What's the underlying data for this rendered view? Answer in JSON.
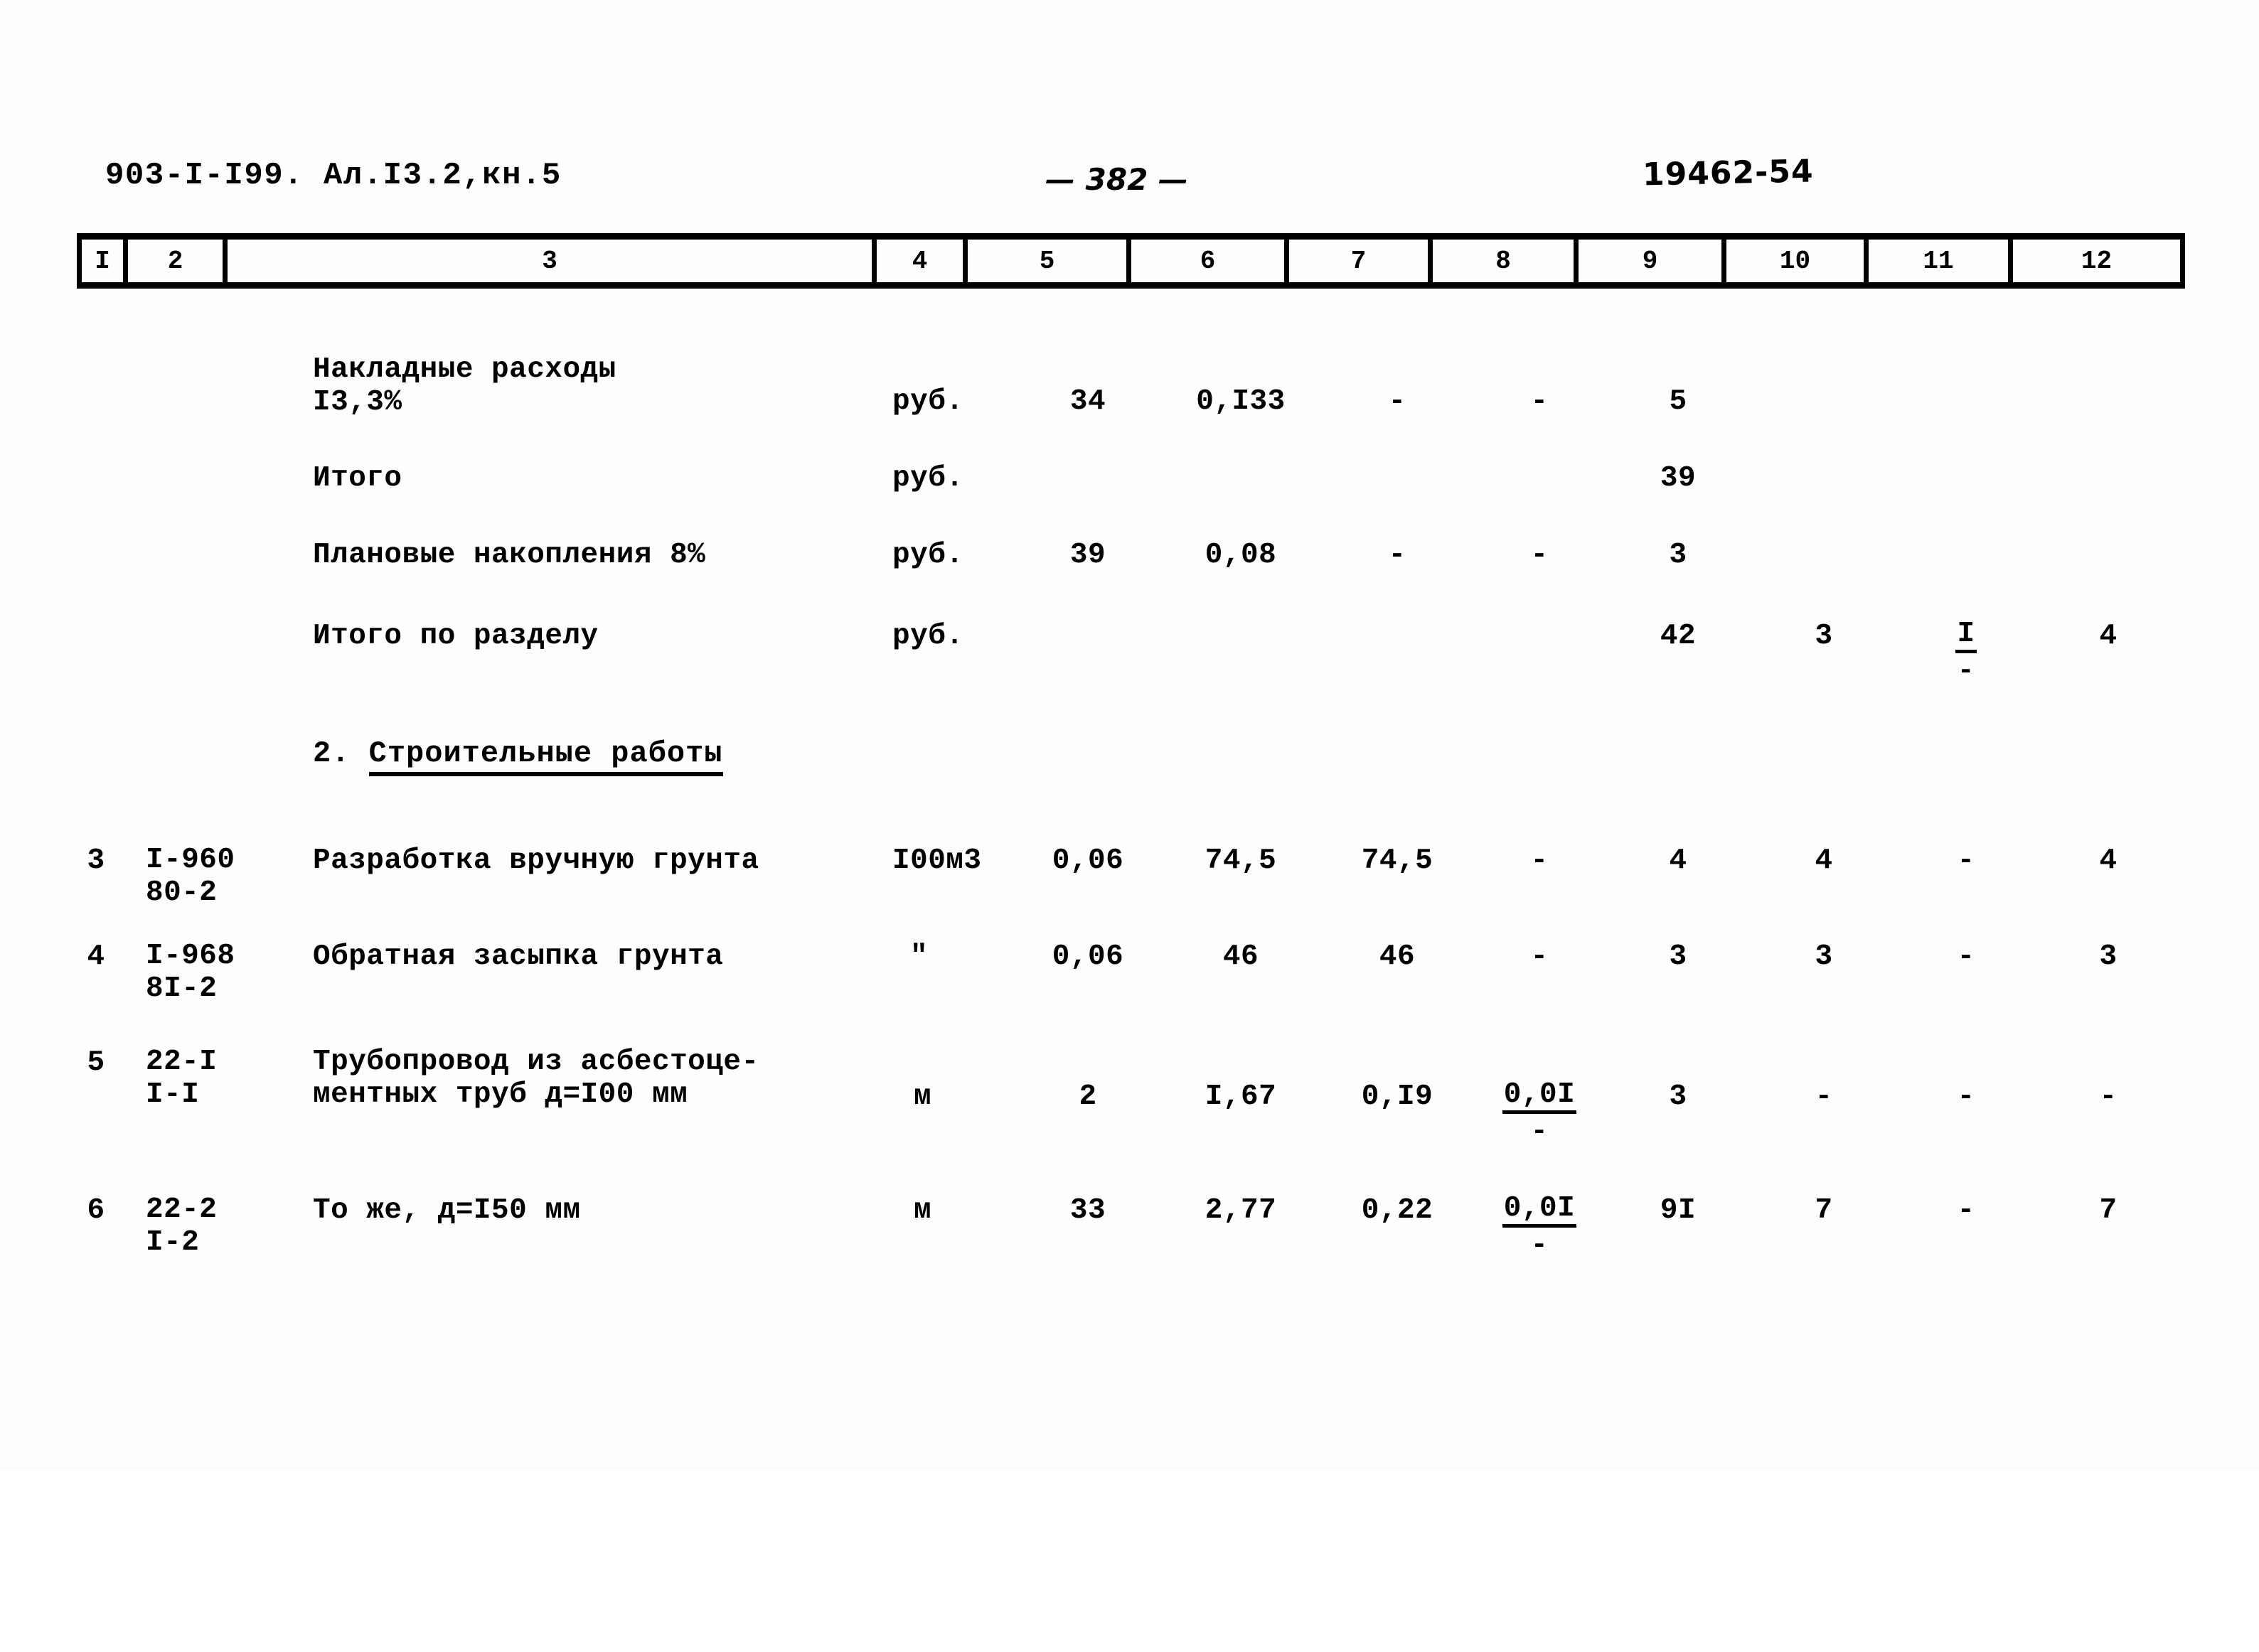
{
  "header": {
    "left_code": "903-I-I99. Ал.I3.2,кн.5",
    "page_number": "— 382 —",
    "right_code": "19462-54"
  },
  "table": {
    "column_numbers": [
      "I",
      "2",
      "3",
      "4",
      "5",
      "6",
      "7",
      "8",
      "9",
      "10",
      "11",
      "12"
    ],
    "rows": [
      {
        "num": "",
        "code": "",
        "name_line1": "Накладные расходы",
        "name_line2": "I3,3%",
        "unit": "руб.",
        "c5": "34",
        "c6": "0,I33",
        "c7": "-",
        "c8": "-",
        "c9": "5",
        "c10": "",
        "c11": "",
        "c12": ""
      },
      {
        "num": "",
        "code": "",
        "name_line1": "Итого",
        "name_line2": "",
        "unit": "руб.",
        "c5": "",
        "c6": "",
        "c7": "",
        "c8": "",
        "c9": "39",
        "c10": "",
        "c11": "",
        "c12": ""
      },
      {
        "num": "",
        "code": "",
        "name_line1": "Плановые накопления 8%",
        "name_line2": "",
        "unit": "руб.",
        "c5": "39",
        "c6": "0,08",
        "c7": "-",
        "c8": "-",
        "c9": "3",
        "c10": "",
        "c11": "",
        "c12": ""
      },
      {
        "num": "",
        "code": "",
        "name_line1": "Итого по разделу",
        "name_line2": "",
        "unit": "руб.",
        "c5": "",
        "c6": "",
        "c7": "",
        "c8": "",
        "c9": "42",
        "c10": "3",
        "c11_num": "I",
        "c11_den": "-",
        "c12": "4"
      },
      {
        "num": "3",
        "code_line1": "I-960",
        "code_line2": "80-2",
        "name_line1": "Разработка вручную грунта",
        "name_line2": "",
        "unit": "I00м3",
        "c5": "0,06",
        "c6": "74,5",
        "c7": "74,5",
        "c8": "-",
        "c9": "4",
        "c10": "4",
        "c11": "-",
        "c12": "4"
      },
      {
        "num": "4",
        "code_line1": "I-968",
        "code_line2": "8I-2",
        "name_line1": "Обратная засыпка грунта",
        "name_line2": "",
        "unit": "\"",
        "c5": "0,06",
        "c6": "46",
        "c7": "46",
        "c8": "-",
        "c9": "3",
        "c10": "3",
        "c11": "-",
        "c12": "3"
      },
      {
        "num": "5",
        "code_line1": "22-I",
        "code_line2": "I-I",
        "name_line1": "Трубопровод из асбестоце-",
        "name_line2": "ментных труб д=I00 мм",
        "unit": "м",
        "c5": "2",
        "c6": "I,67",
        "c7": "0,I9",
        "c8_num": "0,0I",
        "c8_den": "-",
        "c9": "3",
        "c10": "-",
        "c11": "-",
        "c12": "-"
      },
      {
        "num": "6",
        "code_line1": "22-2",
        "code_line2": "I-2",
        "name_line1": "То же, д=I50 мм",
        "name_line2": "",
        "unit": "м",
        "c5": "33",
        "c6": "2,77",
        "c7": "0,22",
        "c8_num": "0,0I",
        "c8_den": "-",
        "c9": "9I",
        "c10": "7",
        "c11": "-",
        "c12": "7"
      }
    ]
  },
  "section_heading": {
    "number": "2. ",
    "title": "Строительные работы"
  }
}
